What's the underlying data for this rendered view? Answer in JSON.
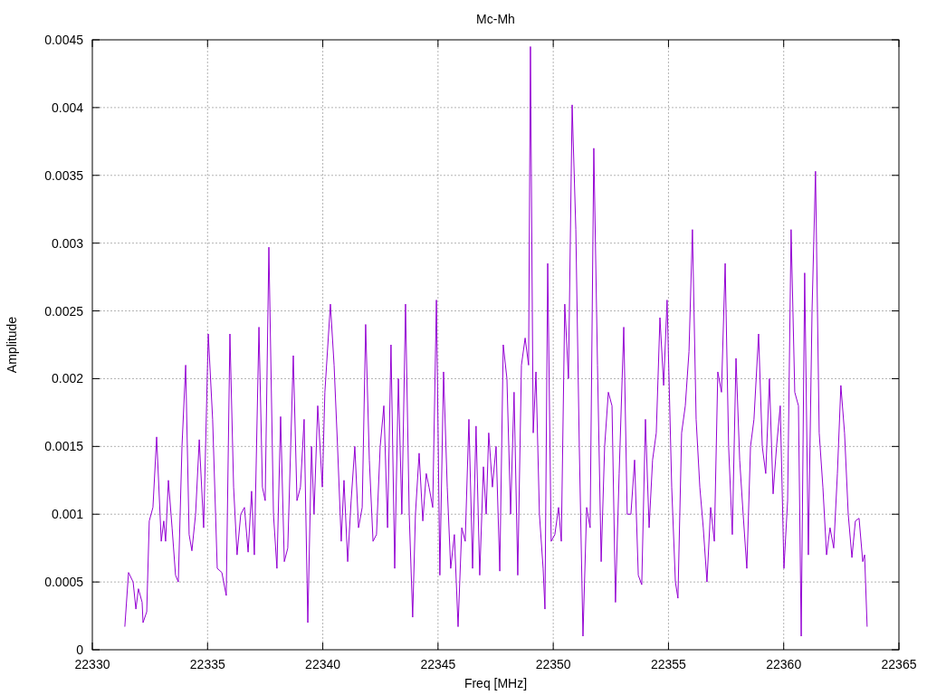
{
  "chart_data": {
    "type": "line",
    "grid": true,
    "title": "Mc-Mh",
    "xlabel": "Freq [MHz]",
    "ylabel": "Amplitude",
    "xlim": [
      22330,
      22365
    ],
    "ylim": [
      0,
      0.0045
    ],
    "xticks": [
      22330,
      22335,
      22340,
      22345,
      22350,
      22355,
      22360,
      22365
    ],
    "yticks": [
      0,
      0.0005,
      0.001,
      0.0015,
      0.002,
      0.0025,
      0.003,
      0.0035,
      0.004,
      0.0045
    ],
    "x": [
      22331.41,
      22331.57,
      22331.77,
      22331.89,
      22332.0,
      22332.16,
      22332.2,
      22332.36,
      22332.47,
      22332.63,
      22332.79,
      22332.99,
      22333.1,
      22333.18,
      22333.3,
      22333.46,
      22333.61,
      22333.73,
      22333.89,
      22334.05,
      22334.2,
      22334.32,
      22334.48,
      22334.64,
      22334.83,
      22335.03,
      22335.22,
      22335.42,
      22335.62,
      22335.81,
      22335.97,
      22336.13,
      22336.28,
      22336.44,
      22336.6,
      22336.76,
      22336.91,
      22337.03,
      22337.23,
      22337.38,
      22337.5,
      22337.66,
      22337.86,
      22338.01,
      22338.17,
      22338.33,
      22338.48,
      22338.72,
      22338.88,
      22339.03,
      22339.19,
      22339.35,
      22339.51,
      22339.62,
      22339.78,
      22339.98,
      22340.09,
      22340.33,
      22340.49,
      22340.64,
      22340.8,
      22340.92,
      22341.08,
      22341.23,
      22341.39,
      22341.55,
      22341.71,
      22341.86,
      22342.02,
      22342.18,
      22342.33,
      22342.49,
      22342.65,
      22342.81,
      22342.96,
      22343.12,
      22343.28,
      22343.43,
      22343.59,
      22343.75,
      22343.9,
      22344.02,
      22344.18,
      22344.34,
      22344.49,
      22344.61,
      22344.77,
      22344.93,
      22345.08,
      22345.24,
      22345.4,
      22345.55,
      22345.71,
      22345.87,
      22346.03,
      22346.18,
      22346.34,
      22346.5,
      22346.65,
      22346.81,
      22346.97,
      22347.09,
      22347.2,
      22347.36,
      22347.52,
      22347.68,
      22347.83,
      22347.99,
      22348.15,
      22348.3,
      22348.46,
      22348.62,
      22348.78,
      22348.93,
      22349.01,
      22349.13,
      22349.25,
      22349.4,
      22349.56,
      22349.64,
      22349.76,
      22349.91,
      22350.07,
      22350.23,
      22350.35,
      22350.5,
      22350.66,
      22350.82,
      22350.98,
      22351.13,
      22351.29,
      22351.45,
      22351.6,
      22351.76,
      22351.92,
      22352.08,
      22352.23,
      22352.39,
      22352.55,
      22352.7,
      22352.86,
      22353.06,
      22353.21,
      22353.37,
      22353.53,
      22353.69,
      22353.84,
      22354.0,
      22354.16,
      22354.31,
      22354.47,
      22354.63,
      22354.79,
      22354.94,
      22355.14,
      22355.3,
      22355.41,
      22355.57,
      22355.73,
      22355.89,
      22356.04,
      22356.2,
      22356.36,
      22356.51,
      22356.67,
      22356.83,
      22356.99,
      22357.14,
      22357.3,
      22357.46,
      22357.61,
      22357.77,
      22357.93,
      22358.09,
      22358.24,
      22358.4,
      22358.56,
      22358.71,
      22358.91,
      22359.07,
      22359.22,
      22359.38,
      22359.54,
      22359.69,
      22359.85,
      22360.01,
      22360.17,
      22360.32,
      22360.48,
      22360.64,
      22360.76,
      22360.91,
      22361.07,
      22361.23,
      22361.38,
      22361.54,
      22361.7,
      22361.86,
      22362.01,
      22362.17,
      22362.33,
      22362.48,
      22362.64,
      22362.8,
      22362.96,
      22363.11,
      22363.27,
      22363.43,
      22363.51,
      22363.62
    ],
    "series": [
      {
        "color": "#9400d3",
        "values": [
          0.00017,
          0.00057,
          0.0005,
          0.0003,
          0.00045,
          0.00035,
          0.0002,
          0.00028,
          0.00095,
          0.00105,
          0.00157,
          0.0008,
          0.00095,
          0.0008,
          0.00125,
          0.0009,
          0.00055,
          0.0005,
          0.0015,
          0.0021,
          0.00085,
          0.00073,
          0.001,
          0.00155,
          0.0009,
          0.00233,
          0.0017,
          0.0006,
          0.00057,
          0.0004,
          0.00233,
          0.0012,
          0.0007,
          0.001,
          0.00105,
          0.00072,
          0.00117,
          0.0007,
          0.00238,
          0.0012,
          0.0011,
          0.00297,
          0.001,
          0.0006,
          0.00172,
          0.00065,
          0.00075,
          0.00217,
          0.0011,
          0.0012,
          0.0017,
          0.0002,
          0.0015,
          0.001,
          0.0018,
          0.0012,
          0.0019,
          0.00255,
          0.0021,
          0.0015,
          0.0008,
          0.00125,
          0.00065,
          0.0011,
          0.0015,
          0.0009,
          0.00105,
          0.0024,
          0.0014,
          0.0008,
          0.00085,
          0.0015,
          0.0018,
          0.0009,
          0.00225,
          0.0006,
          0.002,
          0.001,
          0.00255,
          0.001,
          0.00024,
          0.001,
          0.00145,
          0.00095,
          0.0013,
          0.0012,
          0.00105,
          0.00258,
          0.00055,
          0.00205,
          0.0012,
          0.0006,
          0.00085,
          0.00017,
          0.0009,
          0.0008,
          0.0017,
          0.0006,
          0.00165,
          0.00055,
          0.00135,
          0.001,
          0.0016,
          0.0012,
          0.0015,
          0.00058,
          0.00225,
          0.002,
          0.001,
          0.0019,
          0.00055,
          0.0021,
          0.0023,
          0.0021,
          0.00445,
          0.0016,
          0.00205,
          0.001,
          0.0006,
          0.0003,
          0.00285,
          0.0008,
          0.00085,
          0.00105,
          0.0008,
          0.00255,
          0.002,
          0.00402,
          0.0031,
          0.0015,
          0.0001,
          0.00105,
          0.0009,
          0.0037,
          0.0021,
          0.00065,
          0.0015,
          0.0019,
          0.0018,
          0.00035,
          0.0013,
          0.00238,
          0.001,
          0.001,
          0.0014,
          0.00055,
          0.00048,
          0.0017,
          0.0009,
          0.0014,
          0.0016,
          0.00245,
          0.00195,
          0.00258,
          0.0012,
          0.0005,
          0.00038,
          0.0016,
          0.0018,
          0.0022,
          0.0031,
          0.0017,
          0.0012,
          0.0009,
          0.0005,
          0.00105,
          0.0008,
          0.00205,
          0.0019,
          0.00285,
          0.0015,
          0.00085,
          0.00215,
          0.0014,
          0.001,
          0.0006,
          0.0015,
          0.0017,
          0.00233,
          0.0015,
          0.0013,
          0.002,
          0.00115,
          0.0015,
          0.0018,
          0.0006,
          0.0011,
          0.0031,
          0.0019,
          0.0018,
          0.0001,
          0.00278,
          0.0007,
          0.0025,
          0.00353,
          0.0016,
          0.0012,
          0.0007,
          0.0009,
          0.00075,
          0.0013,
          0.00195,
          0.0016,
          0.001,
          0.00068,
          0.00095,
          0.00097,
          0.00065,
          0.0007,
          0.00017
        ]
      }
    ]
  }
}
